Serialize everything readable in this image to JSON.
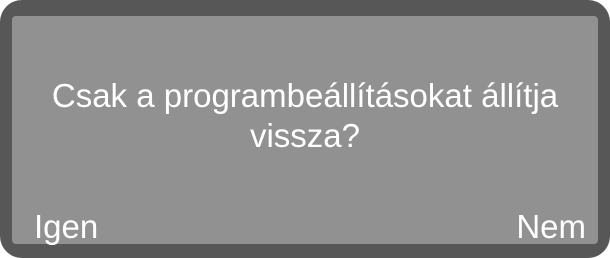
{
  "dialog": {
    "message_line1": "Csak a programbeállításokat állítja",
    "message_line2": "vissza?"
  },
  "softkeys": {
    "left_label": "Igen",
    "right_label": "Nem"
  },
  "colors": {
    "bezel": "#575757",
    "screen": "#919191",
    "text": "#ffffff"
  }
}
